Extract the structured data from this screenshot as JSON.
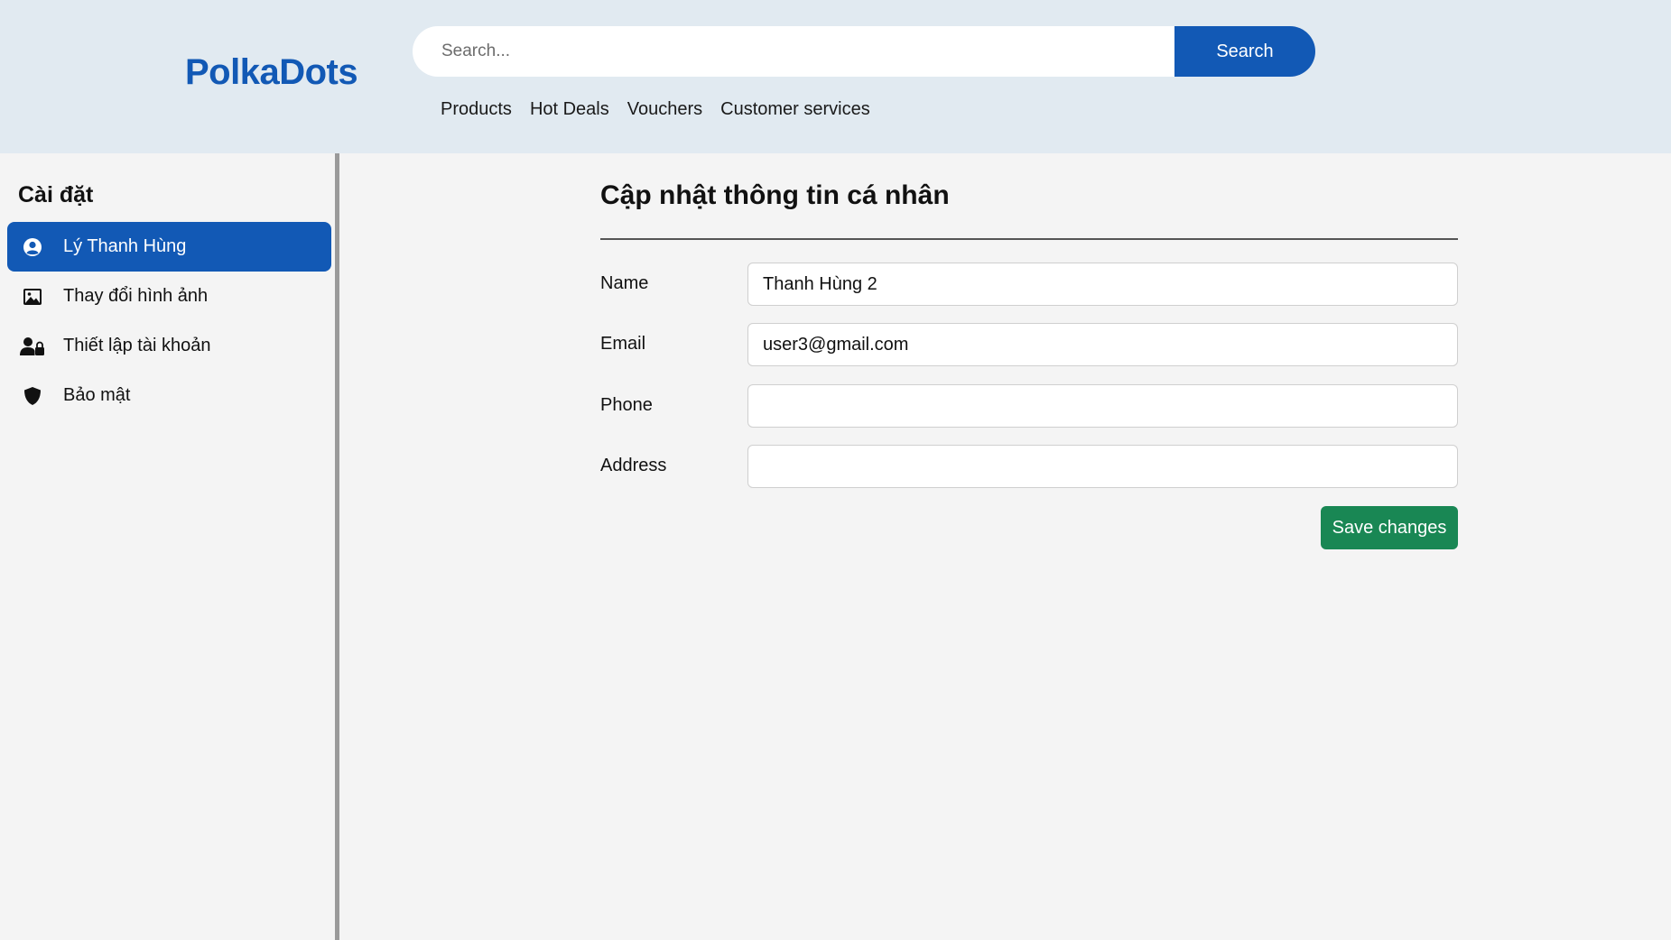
{
  "header": {
    "logo": "PolkaDots",
    "search": {
      "placeholder": "Search...",
      "button_label": "Search"
    },
    "nav": [
      "Products",
      "Hot Deals",
      "Vouchers",
      "Customer services"
    ]
  },
  "sidebar": {
    "title": "Cài đặt",
    "items": [
      {
        "label": "Lý Thanh Hùng",
        "icon": "user-circle-icon",
        "active": true
      },
      {
        "label": "Thay đổi hình ảnh",
        "icon": "image-icon",
        "active": false
      },
      {
        "label": "Thiết lập tài khoản",
        "icon": "user-lock-icon",
        "active": false
      },
      {
        "label": "Bảo mật",
        "icon": "shield-icon",
        "active": false
      }
    ]
  },
  "main": {
    "title": "Cập nhật thông tin cá nhân",
    "fields": [
      {
        "label": "Name",
        "value": "Thanh Hùng 2"
      },
      {
        "label": "Email",
        "value": "user3@gmail.com"
      },
      {
        "label": "Phone",
        "value": ""
      },
      {
        "label": "Address",
        "value": ""
      }
    ],
    "save_label": "Save changes"
  },
  "colors": {
    "brand": "#1259b5",
    "header_bg": "#e1eaf1",
    "page_bg": "#f4f4f4",
    "save": "#198754"
  }
}
